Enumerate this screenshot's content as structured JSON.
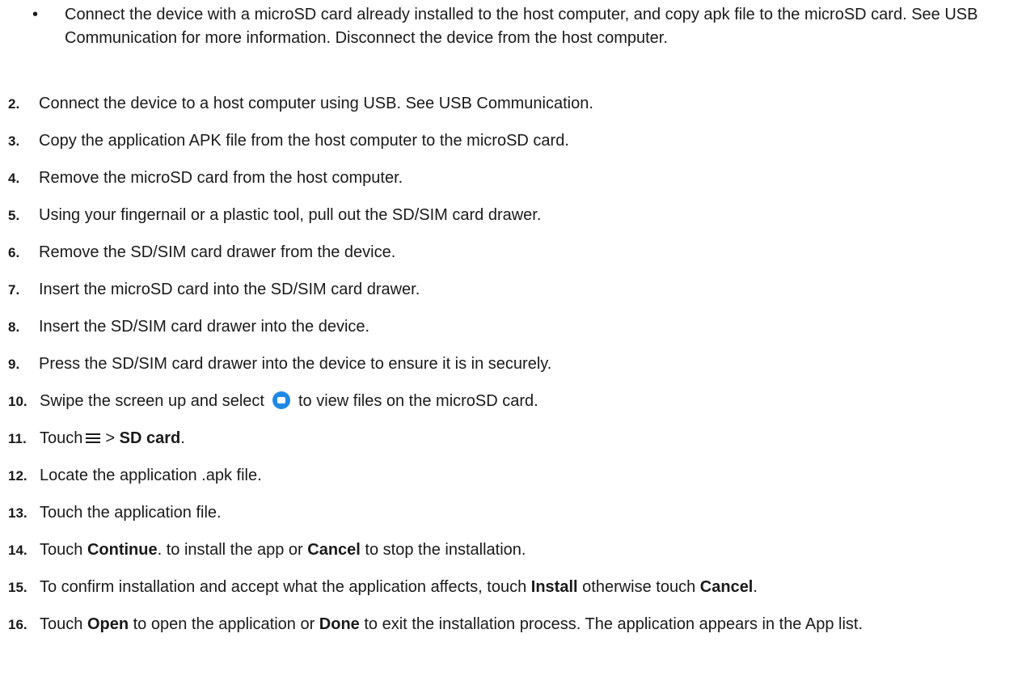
{
  "bullet": {
    "mark": "•",
    "text": "Connect the device with a microSD card already installed to the host computer, and copy apk file to the microSD card. See USB Communication for more information. Disconnect the device from the host computer."
  },
  "steps": [
    {
      "num": "2.",
      "text": "Connect the device to a host computer using USB. See USB Communication."
    },
    {
      "num": "3.",
      "text": "Copy the application APK file from the host computer to the microSD card."
    },
    {
      "num": "4.",
      "text": "Remove the microSD card from the host computer."
    },
    {
      "num": "5.",
      "text": "Using your fingernail or a plastic tool, pull out the SD/SIM card drawer."
    },
    {
      "num": "6.",
      "text": "Remove the SD/SIM card drawer from the device."
    },
    {
      "num": "7.",
      "text": "Insert the microSD card into the SD/SIM card drawer."
    },
    {
      "num": "8.",
      "text": "Insert the SD/SIM card drawer into the device."
    },
    {
      "num": "9.",
      "text": "Press the SD/SIM card drawer into the device to ensure it is in securely."
    }
  ],
  "step10": {
    "num": "10.",
    "before": "Swipe the screen up and select",
    "icon": "files-folder-icon",
    "icon_color": "#1e88e5",
    "after": "to view files on the microSD card."
  },
  "step11": {
    "num": "11.",
    "before": "Touch",
    "icon": "menu-icon",
    "sep": ">",
    "bold": "SD card",
    "after": "."
  },
  "step12": {
    "num": "12.",
    "text": "Locate the application .apk file."
  },
  "step13": {
    "num": "13.",
    "text": "Touch the application file."
  },
  "step14": {
    "num": "14.",
    "t1": "Touch",
    "b1": "Continue",
    "t2": ". to install the app or",
    "b2": "Cancel",
    "t3": "to stop the installation."
  },
  "step15": {
    "num": "15.",
    "t1": "To confirm installation and accept what the application affects, touch",
    "b1": "Install",
    "t2": "otherwise touch",
    "b2": "Cancel",
    "t3": "."
  },
  "step16": {
    "num": "16.",
    "t1": "Touch",
    "b1": "Open",
    "t2": "to open the application or",
    "b2": "Done",
    "t3": "to exit the installation process. The application appears in the App list."
  }
}
